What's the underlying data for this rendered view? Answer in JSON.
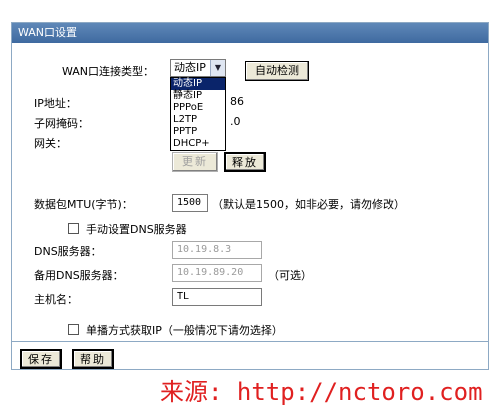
{
  "window": {
    "title": "WAN口设置"
  },
  "wan": {
    "type_label": "WAN口连接类型：",
    "type_selected": "动态IP",
    "auto_detect": "自动检测",
    "options": [
      "动态IP",
      "静态IP",
      "PPPoE",
      "L2TP",
      "PPTP",
      "DHCP+"
    ]
  },
  "ip": {
    "label": "IP地址：",
    "partial": "86"
  },
  "mask": {
    "label": "子网掩码：",
    "partial": ".0"
  },
  "gateway": {
    "label": "网关："
  },
  "buttons": {
    "renew": "更新",
    "release": "释放",
    "save": "保存",
    "help": "帮助"
  },
  "mtu": {
    "label": "数据包MTU(字节)：",
    "value": "1500",
    "hint": "（默认是1500，如非必要，请勿修改）"
  },
  "dns_manual": {
    "label": "手动设置DNS服务器"
  },
  "dns": {
    "label": "DNS服务器：",
    "value": "10.19.8.3"
  },
  "dns2": {
    "label": "备用DNS服务器：",
    "value": "10.19.89.20",
    "hint": "（可选）"
  },
  "host": {
    "label": "主机名：",
    "value": "TL"
  },
  "unicast": {
    "label": "单播方式获取IP（一般情况下请勿选择）"
  },
  "watermark": {
    "text": "来源: http://nctoro.com"
  }
}
